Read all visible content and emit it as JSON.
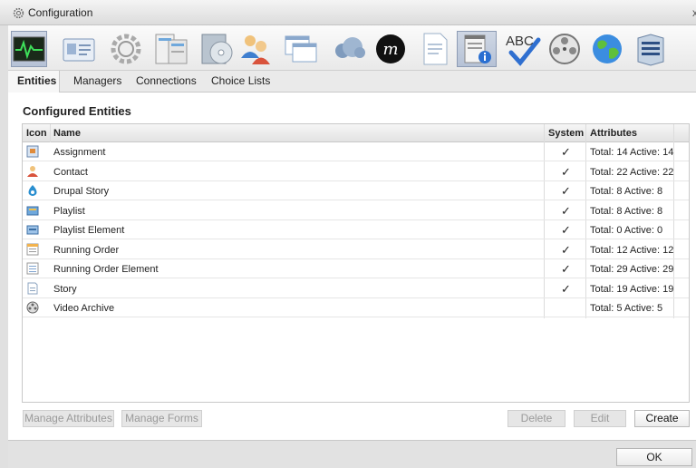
{
  "window": {
    "title": "Configuration",
    "close_glyph": "x"
  },
  "toolbar": {
    "icons": [
      "monitor-waveform-icon",
      "id-card-icon",
      "gear-icon",
      "server-panel-icon",
      "disc-package-icon",
      "users-icon",
      "windows-icon",
      "cloud-icon",
      "m-logo-icon",
      "document-icon",
      "notepad-info-icon",
      "spellcheck-abc-icon",
      "film-reel-icon",
      "globe-icon",
      "server-stack-icon"
    ],
    "spell_label": "ABC"
  },
  "tabs": [
    "Entities",
    "Managers",
    "Connections",
    "Choice Lists"
  ],
  "main": {
    "section_title": "Configured Entities",
    "columns": {
      "icon": "Icon",
      "name": "Name",
      "system": "System",
      "attributes": "Attributes"
    },
    "rows": [
      {
        "icon": "assignment-icon",
        "name": "Assignment",
        "system": "✓",
        "attributes": "Total: 14 Active: 14"
      },
      {
        "icon": "contact-icon",
        "name": "Contact",
        "system": "✓",
        "attributes": "Total: 22 Active: 22"
      },
      {
        "icon": "drupal-icon",
        "name": "Drupal Story",
        "system": "✓",
        "attributes": "Total: 8 Active: 8"
      },
      {
        "icon": "playlist-icon",
        "name": "Playlist",
        "system": "✓",
        "attributes": "Total: 8 Active: 8"
      },
      {
        "icon": "playlist-element-icon",
        "name": "Playlist Element",
        "system": "✓",
        "attributes": "Total: 0 Active: 0"
      },
      {
        "icon": "running-order-icon",
        "name": "Running Order",
        "system": "✓",
        "attributes": "Total: 12 Active: 12"
      },
      {
        "icon": "running-order-element-icon",
        "name": "Running Order Element",
        "system": "✓",
        "attributes": "Total: 29 Active: 29"
      },
      {
        "icon": "story-icon",
        "name": "Story",
        "system": "✓",
        "attributes": "Total: 19 Active: 19"
      },
      {
        "icon": "video-archive-icon",
        "name": "Video Archive",
        "system": "",
        "attributes": "Total: 5 Active: 5"
      }
    ]
  },
  "buttons": {
    "manage_attributes": "Manage Attributes",
    "manage_forms": "Manage Forms",
    "delete": "Delete",
    "edit": "Edit",
    "create": "Create",
    "ok": "OK"
  },
  "colors": {
    "selected_tool": "#b6c2d6",
    "grid_border": "#c8c8c8"
  }
}
